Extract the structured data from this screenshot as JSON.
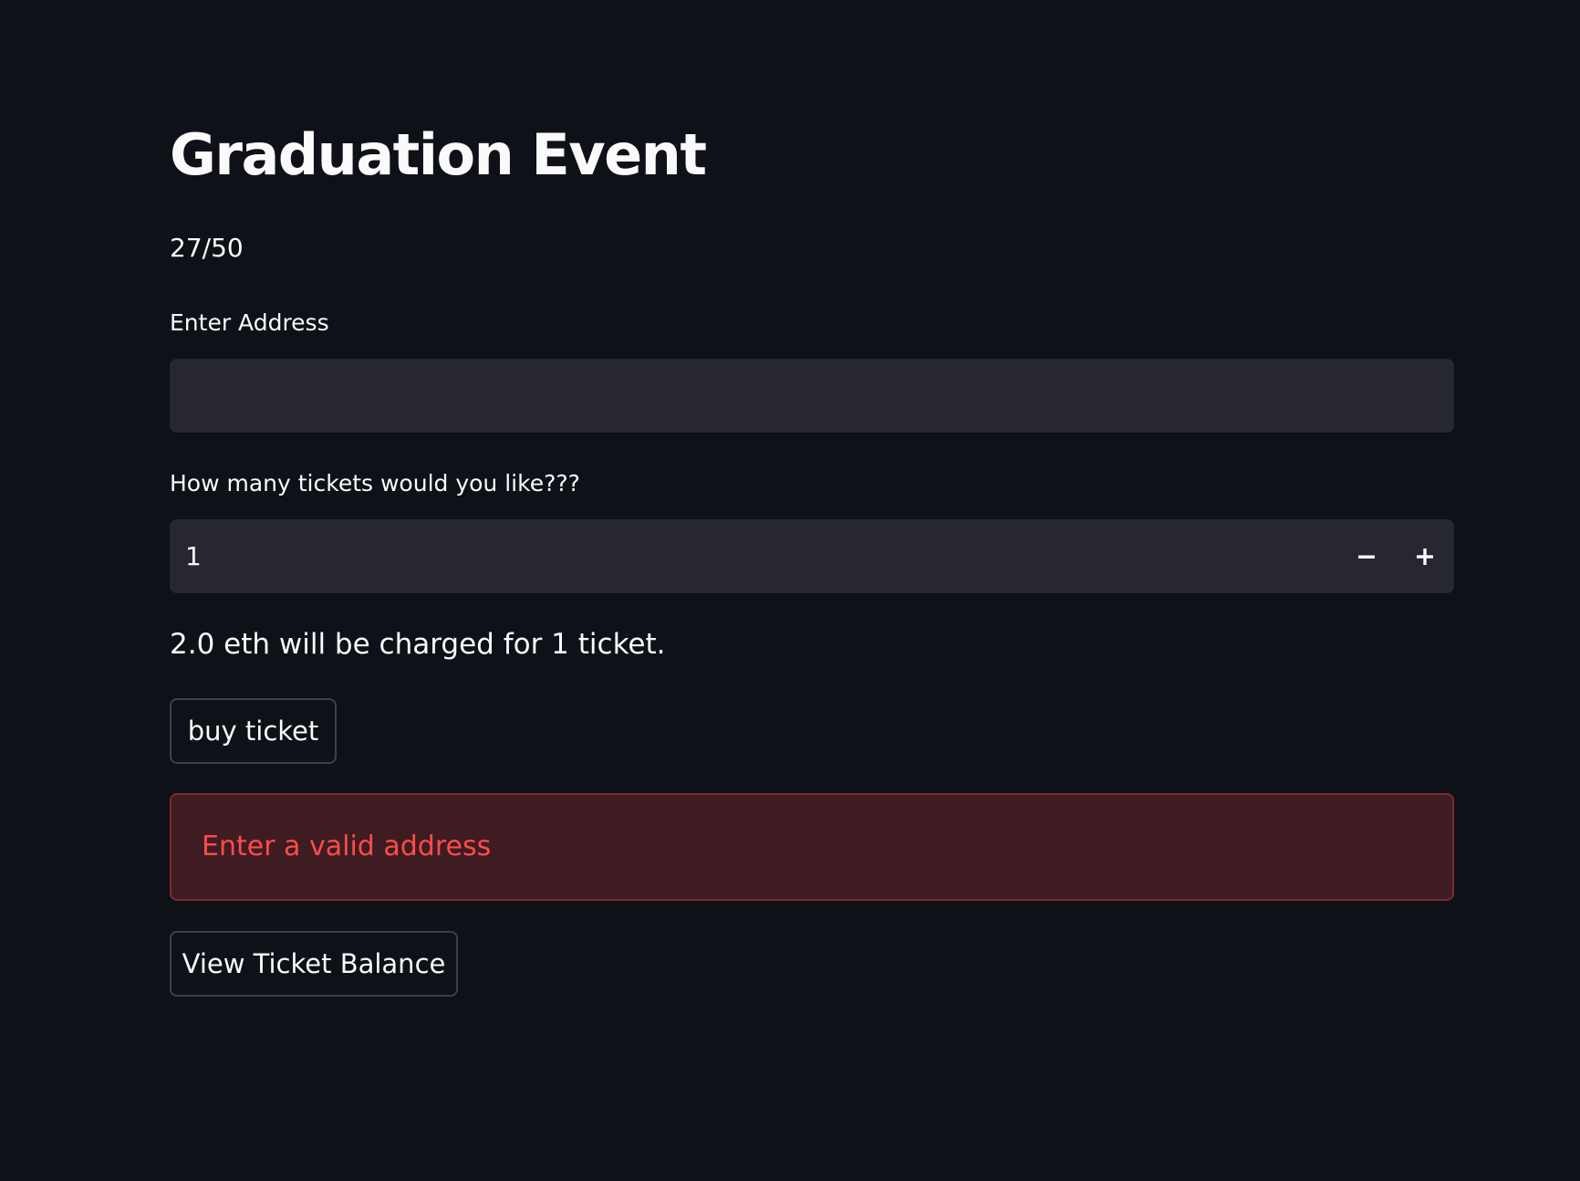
{
  "page": {
    "title": "Graduation Event",
    "ticket_count": "27/50"
  },
  "address": {
    "label": "Enter Address",
    "value": "",
    "placeholder": ""
  },
  "tickets": {
    "label": "How many tickets would you like???",
    "value": "1",
    "decrement_icon": "minus-icon",
    "increment_icon": "plus-icon"
  },
  "charge_text": "2.0 eth will be charged for 1 ticket.",
  "buttons": {
    "buy_label": "buy ticket",
    "view_balance_label": "View Ticket Balance"
  },
  "alert": {
    "message": "Enter a valid address",
    "text_color": "#ff4b4b",
    "background_color": "#3e1c21"
  },
  "theme": {
    "background": "#0e1117",
    "input_background": "#262730",
    "text": "#fafafa"
  }
}
